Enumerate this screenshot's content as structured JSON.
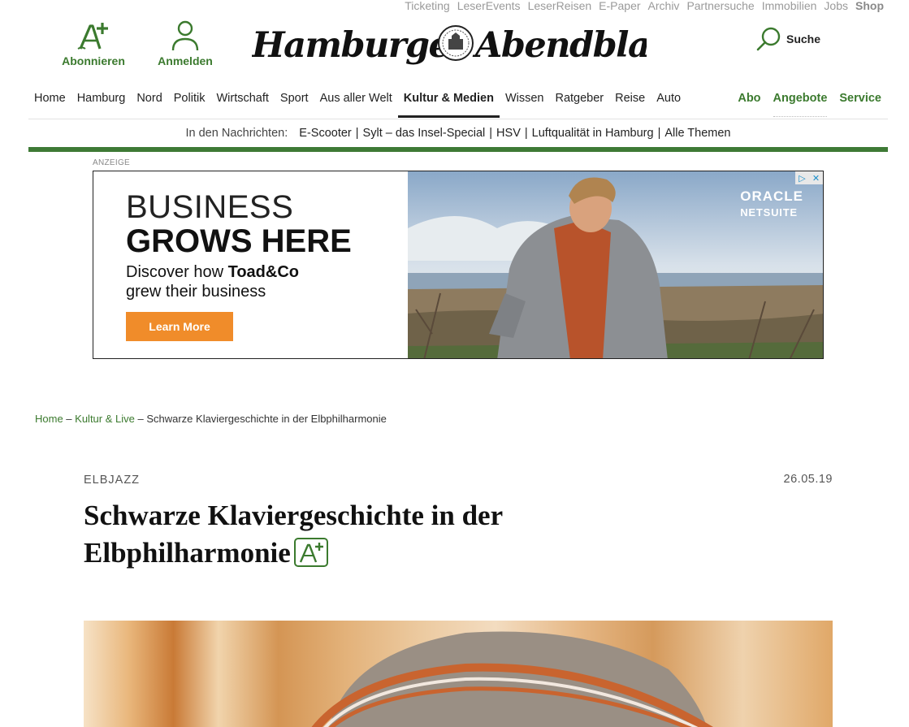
{
  "toplinks": [
    "Ticketing",
    "LeserEvents",
    "LeserReisen",
    "E-Paper",
    "Archiv",
    "Partnersuche",
    "Immobilien",
    "Jobs",
    "Shop"
  ],
  "header": {
    "subscribe_label": "Abonnieren",
    "login_label": "Anmelden",
    "logo_left": "Hamburger",
    "logo_right": "Abendblatt",
    "search_label": "Suche"
  },
  "nav": {
    "items": [
      "Home",
      "Hamburg",
      "Nord",
      "Politik",
      "Wirtschaft",
      "Sport",
      "Aus aller Welt",
      "Kultur & Medien",
      "Wissen",
      "Ratgeber",
      "Reise",
      "Auto"
    ],
    "active": "Kultur & Medien",
    "right": [
      "Abo",
      "Angebote",
      "Service"
    ]
  },
  "ticker": {
    "label": "In den Nachrichten:",
    "items": [
      "E-Scooter",
      "Sylt – das Insel-Special",
      "HSV",
      "Luftqualität in Hamburg",
      "Alle Themen"
    ]
  },
  "ad": {
    "label": "ANZEIGE",
    "line1": "BUSINESS",
    "line2": "GROWS HERE",
    "sub1_prefix": "Discover how ",
    "sub1_brand": "Toad&Co",
    "sub2": "grew their business",
    "cta": "Learn More",
    "brand1": "ORACLE",
    "brand2": "NETSUITE"
  },
  "breadcrumb": {
    "home": "Home",
    "section": "Kultur & Live",
    "current": "Schwarze Klaviergeschichte in der Elbphilharmonie",
    "sep": " – "
  },
  "article": {
    "kicker": "ELBJAZZ",
    "date": "26.05.19",
    "title": "Schwarze Klaviergeschichte in der Elbphilharmonie"
  },
  "colors": {
    "brand_green": "#3b7a2e",
    "green_bar": "#3e7a36",
    "ad_button": "#f08c2a"
  }
}
